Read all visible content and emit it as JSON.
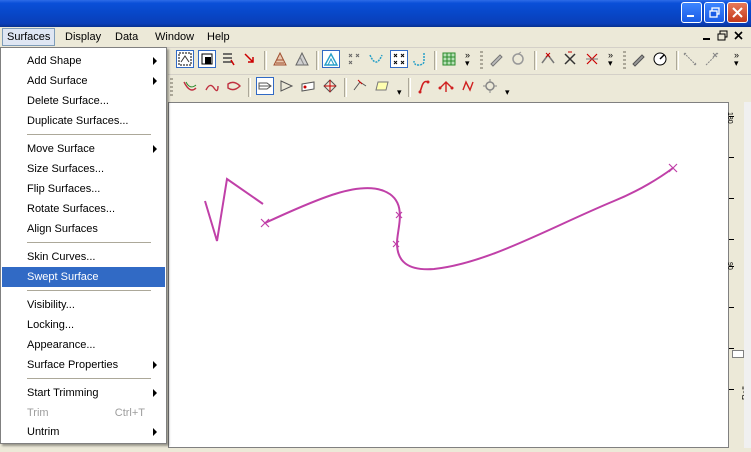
{
  "menubar": {
    "items": [
      {
        "label": "Surfaces",
        "active": true
      },
      {
        "label": "Display"
      },
      {
        "label": "Data"
      },
      {
        "label": "Window"
      },
      {
        "label": "Help"
      }
    ]
  },
  "surfaces_menu": {
    "items": [
      {
        "label": "Add Shape",
        "submenu": true
      },
      {
        "label": "Add Surface",
        "submenu": true
      },
      {
        "label": "Delete Surface..."
      },
      {
        "label": "Duplicate Surfaces..."
      },
      {
        "label": "Move Surface",
        "submenu": true
      },
      {
        "label": "Size Surfaces..."
      },
      {
        "label": "Flip Surfaces..."
      },
      {
        "label": "Rotate Surfaces..."
      },
      {
        "label": "Align Surfaces"
      },
      {
        "label": "Skin Curves..."
      },
      {
        "label": "Swept Surface",
        "highlighted": true
      },
      {
        "label": "Visibility..."
      },
      {
        "label": "Locking..."
      },
      {
        "label": "Appearance..."
      },
      {
        "label": "Surface Properties",
        "submenu": true
      },
      {
        "label": "Start Trimming",
        "submenu": true
      },
      {
        "label": "Trim",
        "shortcut": "Ctrl+T",
        "disabled": true
      },
      {
        "label": "Untrim",
        "submenu": true
      }
    ]
  },
  "ruler": {
    "labels": [
      "180",
      "90",
      "Roll"
    ]
  },
  "colors": {
    "titlebar": "#0a4fd8",
    "curve": "#c040a8",
    "highlight": "#316ac5",
    "menu_bg": "#ece9d8"
  },
  "icons": {
    "window": [
      "minimize-icon",
      "restore-icon",
      "close-icon"
    ],
    "mdi": [
      "mdi-minimize-icon",
      "mdi-restore-icon",
      "mdi-close-icon"
    ]
  }
}
